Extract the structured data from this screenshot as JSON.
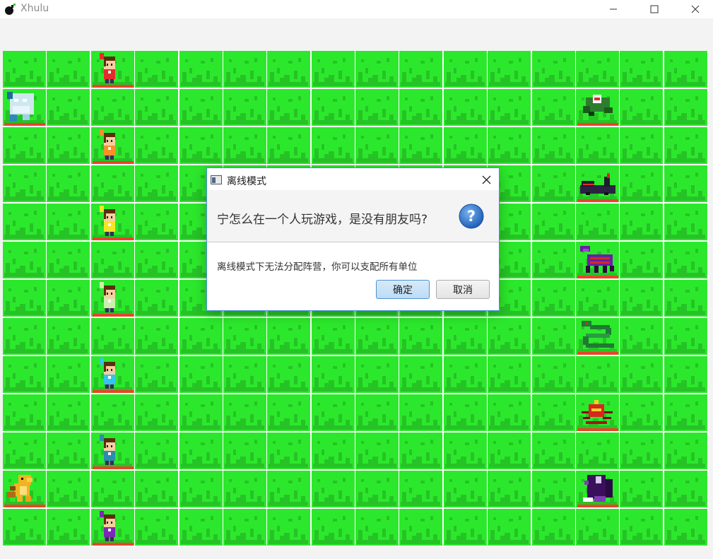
{
  "window": {
    "title": "Xhulu",
    "icon": "bomb-icon"
  },
  "board": {
    "columns": 16,
    "rows": 13,
    "tile_color": "#2ce82c",
    "tile_shade": "#26c326",
    "hp_bar_color": "#e8442a",
    "units": [
      {
        "id": "hero-red",
        "icon": "hero-red-icon",
        "side": "player",
        "col": 2,
        "row": 0,
        "color": "#e52b2b"
      },
      {
        "id": "ice-golem",
        "icon": "ice-golem-icon",
        "side": "player",
        "col": 0,
        "row": 1,
        "color": "#cfe8f0"
      },
      {
        "id": "hero-orange",
        "icon": "hero-orange-icon",
        "side": "player",
        "col": 2,
        "row": 2,
        "color": "#f7902a"
      },
      {
        "id": "hero-yellow",
        "icon": "hero-yellow-icon",
        "side": "player",
        "col": 2,
        "row": 4,
        "color": "#f3e526"
      },
      {
        "id": "hero-lime",
        "icon": "hero-lime-icon",
        "side": "player",
        "col": 2,
        "row": 6,
        "color": "#cdf0a8"
      },
      {
        "id": "hero-cyan",
        "icon": "hero-cyan-icon",
        "side": "player",
        "col": 2,
        "row": 8,
        "color": "#35c5ec"
      },
      {
        "id": "hero-teal",
        "icon": "hero-teal-icon",
        "side": "player",
        "col": 2,
        "row": 10,
        "color": "#2a8dae"
      },
      {
        "id": "dragon-orange",
        "icon": "fire-dragon-icon",
        "side": "player",
        "col": 0,
        "row": 11,
        "color": "#f0b422"
      },
      {
        "id": "hero-purple",
        "icon": "hero-purple-icon",
        "side": "player",
        "col": 2,
        "row": 12,
        "color": "#7a2ab6"
      },
      {
        "id": "frog-monster",
        "icon": "frog-monster-icon",
        "side": "enemy",
        "col": 13,
        "row": 1,
        "color": "#2e7d2e"
      },
      {
        "id": "shadow-crocodile",
        "icon": "shadow-crocodile-icon",
        "side": "enemy",
        "col": 13,
        "row": 3,
        "color": "#2b2342"
      },
      {
        "id": "purple-scorpion",
        "icon": "scorpion-icon",
        "side": "enemy",
        "col": 13,
        "row": 5,
        "color": "#6a1fa3"
      },
      {
        "id": "green-serpent",
        "icon": "serpent-icon",
        "side": "enemy",
        "col": 13,
        "row": 7,
        "color": "#1f7a32"
      },
      {
        "id": "red-spider",
        "icon": "spider-icon",
        "side": "enemy",
        "col": 13,
        "row": 9,
        "color": "#d8261e"
      },
      {
        "id": "purple-rat",
        "icon": "giant-rat-icon",
        "side": "enemy",
        "col": 13,
        "row": 11,
        "color": "#3a0f5c"
      }
    ]
  },
  "dialog": {
    "title": "离线模式",
    "question": "宁怎么在一个人玩游戏，是没有朋友吗?",
    "message": "离线模式下无法分配阵营，你可以支配所有单位",
    "ok_label": "确定",
    "cancel_label": "取消",
    "icon": "question-icon"
  }
}
